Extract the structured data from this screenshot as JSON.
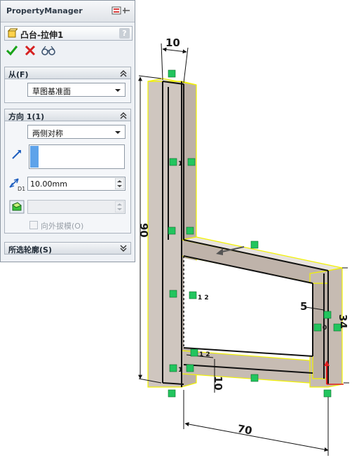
{
  "manager": {
    "title": "PropertyManager"
  },
  "feature": {
    "title": "凸台-拉伸1",
    "help": "?"
  },
  "sections": {
    "from": {
      "title": "从(F)",
      "start_condition": "草图基准面"
    },
    "direction1": {
      "title": "方向 1(1)",
      "end_condition": "两侧对称",
      "depth": "10.00mm",
      "draft_outward_label": "向外拔模(O)"
    },
    "selected_contours": {
      "title": "所选轮廓(S)"
    }
  },
  "dimensions": {
    "top_width": "10",
    "height": "90",
    "right_wall": "5",
    "right_height": "34",
    "bottom_thickness": "10",
    "length": "70"
  },
  "relations": {
    "r1": "1",
    "r2": "1 2",
    "r3": "0",
    "r4": "1 2",
    "r5": "1"
  },
  "colors": {
    "accept": "#19a319",
    "cancel": "#d62020",
    "highlight": "#ffff55",
    "relation": "#22c55e"
  }
}
